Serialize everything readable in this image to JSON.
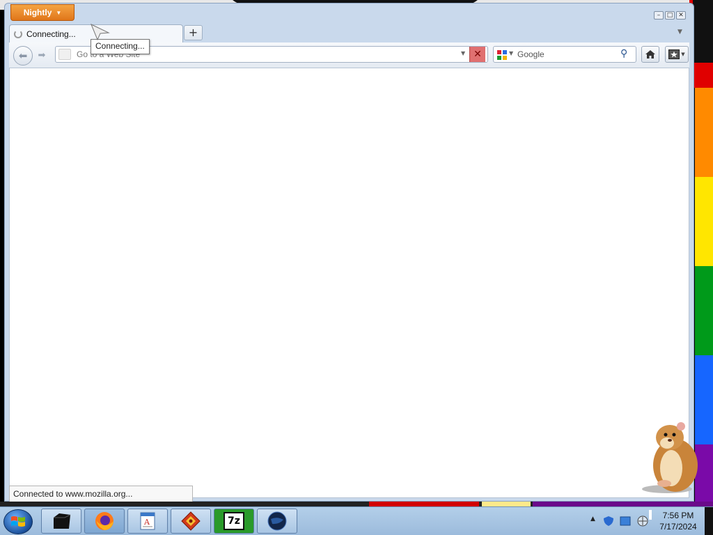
{
  "browser": {
    "menu_button_label": "Nightly",
    "tab": {
      "title": "Connecting..."
    },
    "tooltip": "Connecting...",
    "urlbar": {
      "placeholder": "Go to a Web Site",
      "value": ""
    },
    "searchbar": {
      "placeholder": "Google",
      "engine_icon": "google-icon"
    },
    "status_text": "Connected to www.mozilla.org..."
  },
  "taskbar": {
    "time": "7:56 PM",
    "date": "7/17/2024",
    "apps": [
      {
        "name": "taskbar-app-box",
        "icon": "black-box-icon"
      },
      {
        "name": "taskbar-app-firefox",
        "icon": "firefox-icon"
      },
      {
        "name": "taskbar-app-wordpad",
        "icon": "wordpad-icon"
      },
      {
        "name": "taskbar-app-game",
        "icon": "red-diamond-icon"
      },
      {
        "name": "taskbar-app-7zip",
        "icon": "7zip-icon",
        "label": "7z"
      },
      {
        "name": "taskbar-app-globe",
        "icon": "dark-globe-icon"
      }
    ]
  },
  "colors": {
    "menu_button": "#e0761a",
    "window_frame": "#c9d9ec",
    "stop_button": "#e07070",
    "taskbar": "#9cbbdc"
  }
}
